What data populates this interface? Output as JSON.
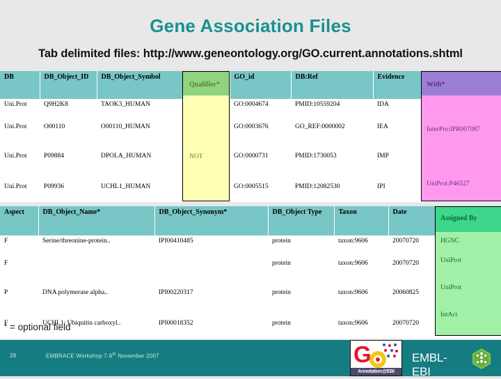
{
  "slide": {
    "title": "Gene Association Files",
    "subtitle": "Tab delimited files: http://www.geneontology.org/GO.current.annotations.shtml",
    "optional_note_star": "*",
    "optional_note_text": " = optional field",
    "colors": {
      "title": "#18918f",
      "header_teal": "#79c6c6",
      "qualifier_header": "#8fd47e",
      "qualifier_body": "#ffffb4",
      "with_header": "#9b7fd4",
      "with_body": "#ff99ee",
      "assignedby_header": "#3dd68c",
      "assignedby_body": "#a2f0a8",
      "footer_bar": "#157d81"
    }
  },
  "table1": {
    "headers": [
      "DB",
      "DB_Object_ID",
      "DB_Object_Symbol",
      "Qualifier*",
      "GO_id",
      "DB:Ref",
      "Evidence",
      "With*"
    ],
    "rows": [
      {
        "db": "Uni.Prot",
        "db_object_id": "Q9H2K8",
        "db_object_symbol": "TAOK3_HUMAN",
        "qualifier": "",
        "go_id": "GO:0004674",
        "db_ref": "PMID:10559204",
        "evidence": "IDA",
        "with": ""
      },
      {
        "db": "Uni.Prot",
        "db_object_id": "O00110",
        "db_object_symbol": "O00110_HUMAN",
        "qualifier": "",
        "go_id": "GO:0003676",
        "db_ref": "GO_REF:0000002",
        "evidence": "IEA",
        "with": "InterPro:IPR007087"
      },
      {
        "db": "Uni.Prot",
        "db_object_id": "P09884",
        "db_object_symbol": "DPOLA_HUMAN",
        "qualifier": "NOT",
        "go_id": "GO:0000731",
        "db_ref": "PMID:1730053",
        "evidence": "IMP",
        "with": ""
      },
      {
        "db": "Uni.Prot",
        "db_object_id": "P09936",
        "db_object_symbol": "UCHL1_HUMAN",
        "qualifier": "",
        "go_id": "GO:0005515",
        "db_ref": "PMID:12082530",
        "evidence": "IPI",
        "with": "UniProt:P46527"
      }
    ]
  },
  "table2": {
    "headers": [
      "Aspect",
      "DB_Object_Name*",
      "DB_Object_Synonym*",
      "DB_Object Type",
      "Taxon",
      "Date",
      "Assigned By"
    ],
    "rows": [
      {
        "aspect": "F",
        "db_object_name": "Serine/threonine-protein..",
        "db_object_synonym": "IPI00410485",
        "db_object_type": "protein",
        "taxon": "taxon:9606",
        "date": "20070720",
        "assigned_by": "HGNC"
      },
      {
        "aspect": "F",
        "db_object_name": "",
        "db_object_synonym": "",
        "db_object_type": "protein",
        "taxon": "taxon:9606",
        "date": "20070720",
        "assigned_by": "UniProt"
      },
      {
        "aspect": "P",
        "db_object_name": "DNA polymerase alpha..",
        "db_object_synonym": "IPI00220317",
        "db_object_type": "protein",
        "taxon": "taxon:9606",
        "date": "20060825",
        "assigned_by": "UniProt"
      },
      {
        "aspect": "F",
        "db_object_name": "UCHL1: Ubiquitin carboxyl..",
        "db_object_synonym": "IPI00018352",
        "db_object_type": "protein",
        "taxon": "taxon:9606",
        "date": "20070720",
        "assigned_by": "IntAct"
      }
    ]
  },
  "footer": {
    "slide_number": "28",
    "event_prefix": "EMBRACE Workshop  7-9",
    "event_sup": "th",
    "event_suffix": " November 2007",
    "go_logo_letter": "G",
    "go_logo_ribbon": "Annotation@EBI",
    "ebi_wordmark": "EMBL-EBI"
  }
}
